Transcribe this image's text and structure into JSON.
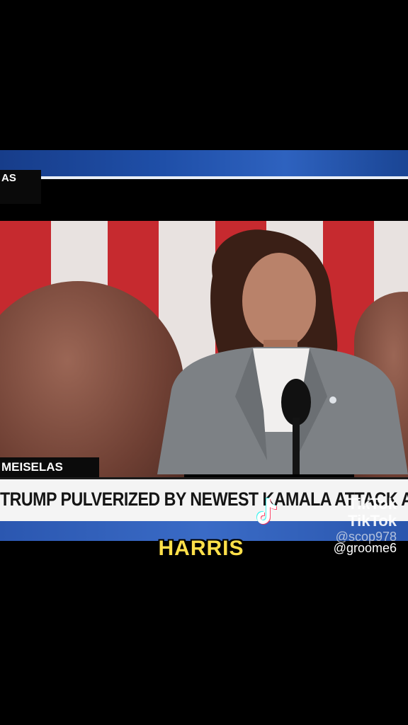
{
  "video": {
    "top_tag": "AS",
    "lower_third_name": "MEISELAS",
    "headline": "TRUMP PULVERIZED BY NEWEST KAMALA ATTACK AD"
  },
  "caption": {
    "text": "HARRIS"
  },
  "watermark": {
    "brand": "TikTok",
    "brand_2": "TikTok",
    "user_1": "@scop978",
    "user_2": "@groome6"
  },
  "colors": {
    "banner_blue": "#1f4fa8",
    "caption_yellow": "#ffe04a",
    "flag_red": "#c62a2f"
  }
}
